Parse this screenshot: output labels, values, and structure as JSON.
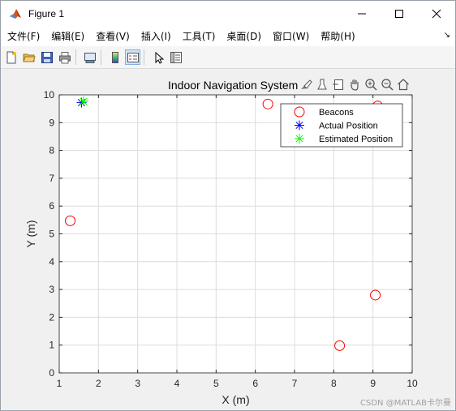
{
  "window": {
    "title": "Figure 1",
    "controls": [
      "minimize",
      "maximize",
      "close"
    ]
  },
  "menubar": {
    "items": [
      "文件(F)",
      "编辑(E)",
      "查看(V)",
      "插入(I)",
      "工具(T)",
      "桌面(D)",
      "窗口(W)",
      "帮助(H)"
    ],
    "overflow_icon": "double-arrow-icon"
  },
  "toolbar": {
    "icons": [
      "new-figure-icon",
      "open-icon",
      "save-icon",
      "print-icon",
      "link-plot-icon",
      "colorbar-icon",
      "legend-icon",
      "edit-plot-icon",
      "property-inspector-icon"
    ]
  },
  "axes_toolbar": {
    "icons": [
      "brush-icon",
      "data-tips-icon",
      "export-icon",
      "pan-icon",
      "zoom-in-icon",
      "zoom-out-icon",
      "home-icon"
    ]
  },
  "chart_data": {
    "type": "scatter",
    "title": "Indoor Navigation System",
    "xlabel": "X (m)",
    "ylabel": "Y (m)",
    "xlim": [
      1,
      10
    ],
    "ylim": [
      0,
      10
    ],
    "xticks": [
      "1",
      "2",
      "3",
      "4",
      "5",
      "6",
      "7",
      "8",
      "9",
      "10"
    ],
    "yticks": [
      "0",
      "1",
      "2",
      "3",
      "4",
      "5",
      "6",
      "7",
      "8",
      "9",
      "10"
    ],
    "grid": true,
    "legend_position": "top-right",
    "series": [
      {
        "name": "Beacons",
        "marker": "circle",
        "color": "#ff0000",
        "points": [
          [
            1.28,
            5.47
          ],
          [
            6.32,
            9.67
          ],
          [
            9.12,
            9.6
          ],
          [
            8.15,
            0.98
          ],
          [
            9.06,
            2.8
          ]
        ]
      },
      {
        "name": "Actual Position",
        "marker": "asterisk",
        "color": "#0000ff",
        "points": [
          [
            1.57,
            9.72
          ]
        ]
      },
      {
        "name": "Estimated Position",
        "marker": "asterisk",
        "color": "#00ff00",
        "points": [
          [
            1.62,
            9.77
          ]
        ]
      }
    ]
  },
  "watermark": "CSDN @MATLAB卡尔曼"
}
